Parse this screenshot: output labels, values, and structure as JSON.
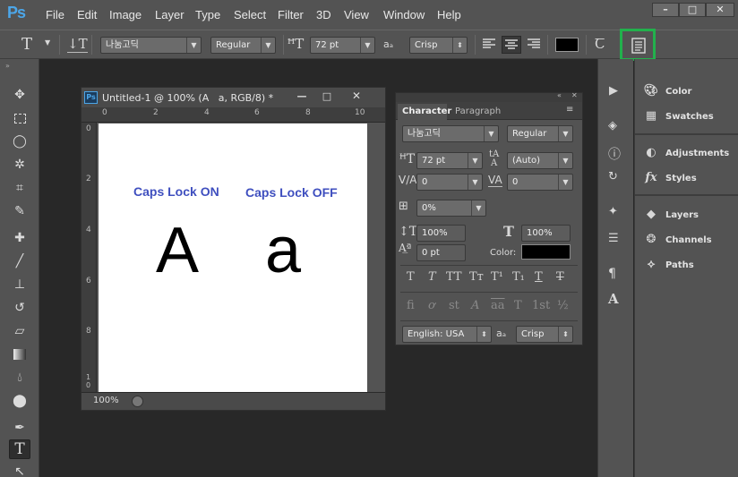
{
  "menubar": {
    "logo": "Ps",
    "items": [
      "File",
      "Edit",
      "Image",
      "Layer",
      "Type",
      "Select",
      "Filter",
      "3D",
      "View",
      "Window",
      "Help"
    ],
    "window_buttons": [
      "–",
      "□",
      "✕"
    ]
  },
  "options_bar": {
    "font_family": "나눔고딕",
    "font_style": "Regular",
    "font_size": "72 pt",
    "antialias_icon_text": "aₐ",
    "antialias": "Crisp",
    "text_color": "#000000",
    "highlight_color": "#22b14c"
  },
  "document": {
    "title": "Untitled-1 @ 100% (A   a, RGB/8) *",
    "zoom": "100%",
    "ruler_h": [
      "0",
      "2",
      "4",
      "6",
      "8",
      "10"
    ],
    "ruler_v": [
      "0",
      "2",
      "4",
      "6",
      "8",
      "1\n0"
    ],
    "label_on": "Caps Lock ON",
    "label_off": "Caps Lock OFF",
    "letter_upper": "A",
    "letter_lower": "a",
    "label_color": "#3f4fbf"
  },
  "character_panel": {
    "tabs": [
      "Character",
      "Paragraph"
    ],
    "font_family": "나눔고딕",
    "font_style": "Regular",
    "font_size": "72 pt",
    "leading": "(Auto)",
    "kerning": "0",
    "tracking": "0",
    "tsume": "0%",
    "vertical_scale": "100%",
    "horizontal_scale": "100%",
    "baseline_shift": "0 pt",
    "color_label": "Color:",
    "language": "English: USA",
    "antialias_icon_text": "aₐ",
    "antialias": "Crisp",
    "style_buttons": [
      "T",
      "T",
      "TT",
      "Tт",
      "T¹",
      "T₁",
      "T",
      "T"
    ],
    "opentype_buttons": [
      "fi",
      "ơ",
      "st",
      "A",
      "aa",
      "T",
      "1st",
      "½"
    ]
  },
  "right_panels": {
    "group1": [
      "Color",
      "Swatches"
    ],
    "group2": [
      "Adjustments",
      "Styles"
    ],
    "group3": [
      "Layers",
      "Channels",
      "Paths"
    ]
  }
}
